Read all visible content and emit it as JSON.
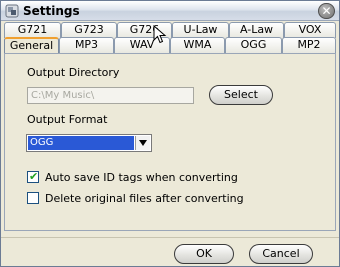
{
  "window": {
    "title": "Settings",
    "close_glyph": "✕"
  },
  "tabs": {
    "top": [
      "G721",
      "G723",
      "G726",
      "U-Law",
      "A-Law",
      "VOX"
    ],
    "bottom": [
      "General",
      "MP3",
      "WAV",
      "WMA",
      "OGG",
      "MP2"
    ],
    "active": "General"
  },
  "general": {
    "output_directory_label": "Output Directory",
    "output_directory_value": "C:\\My Music\\",
    "select_button": "Select",
    "output_format_label": "Output Format",
    "output_format_value": "OGG",
    "auto_save_label": "Auto save ID tags when  converting",
    "auto_save_checked": true,
    "delete_label": "Delete original files after converting",
    "delete_checked": false
  },
  "buttons": {
    "ok": "OK",
    "cancel": "Cancel"
  },
  "colors": {
    "accent_tab": "#f0a030",
    "selection": "#2a59d6",
    "check": "#21a121"
  }
}
